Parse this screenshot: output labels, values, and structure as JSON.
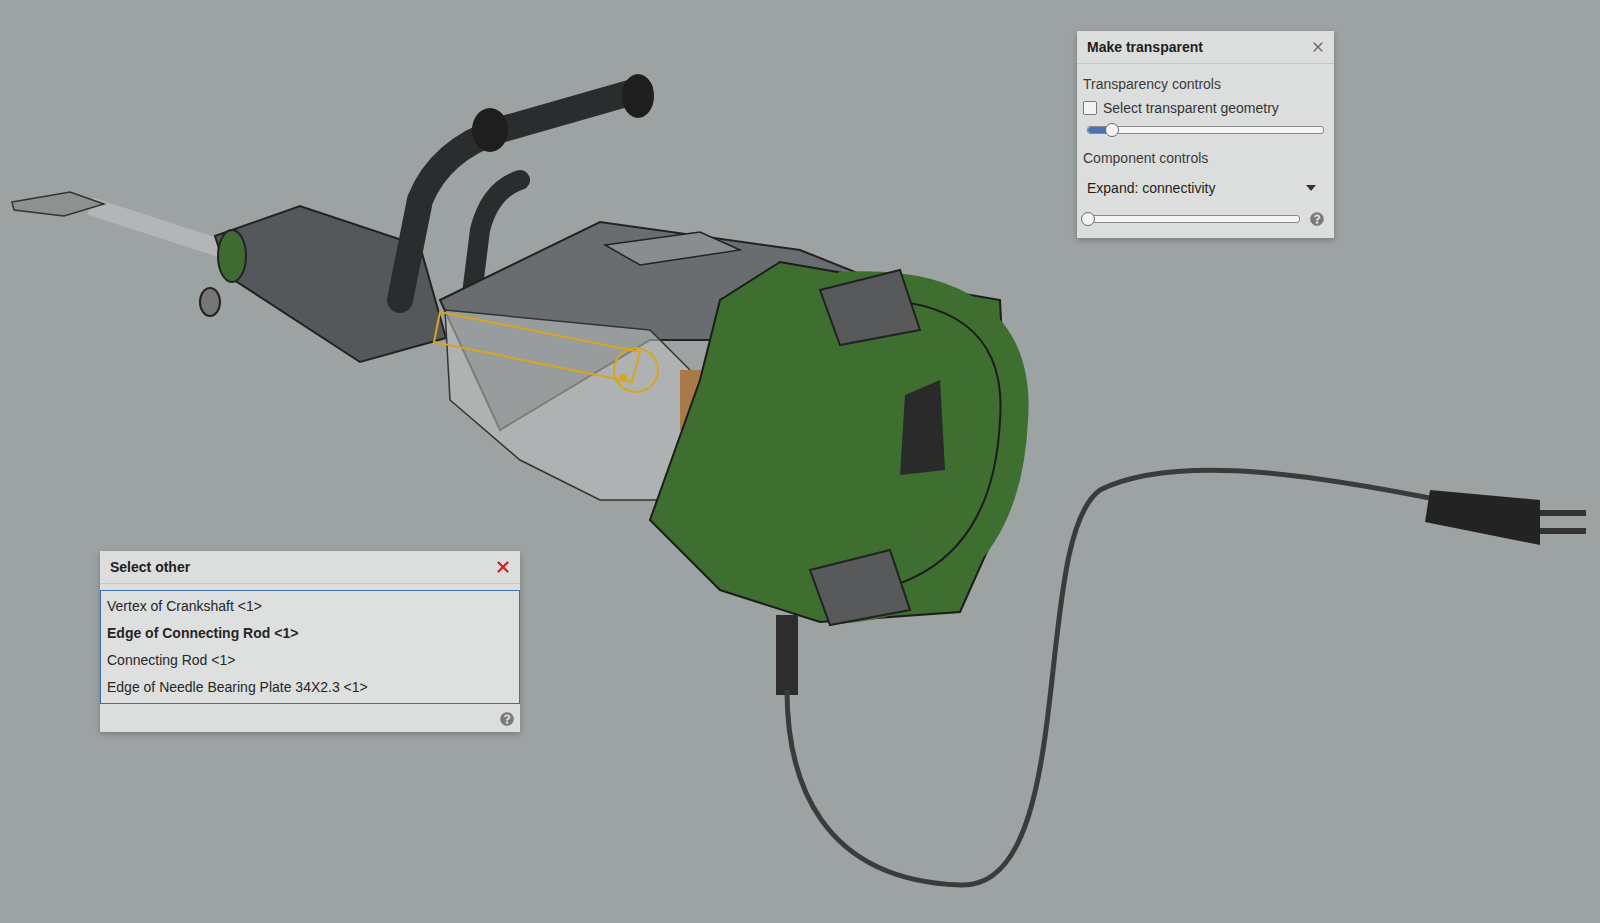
{
  "make_transparent": {
    "title": "Make transparent",
    "transparency_controls": {
      "label": "Transparency controls",
      "checkbox": {
        "label": "Select transparent geometry",
        "checked": false
      },
      "slider": {
        "level": 0.1
      }
    },
    "component_controls": {
      "label": "Component controls",
      "dropdown": {
        "value": "Expand: connectivity"
      },
      "slider": {
        "level": 0
      }
    }
  },
  "select_other": {
    "title": "Select other",
    "items": [
      {
        "label": "Vertex of Crankshaft <1>",
        "selected": false
      },
      {
        "label": "Edge of Connecting Rod <1>",
        "selected": true
      },
      {
        "label": "Connecting Rod <1>",
        "selected": false
      },
      {
        "label": "Edge of Needle Bearing Plate 34X2.3 <1>",
        "selected": false
      }
    ]
  }
}
